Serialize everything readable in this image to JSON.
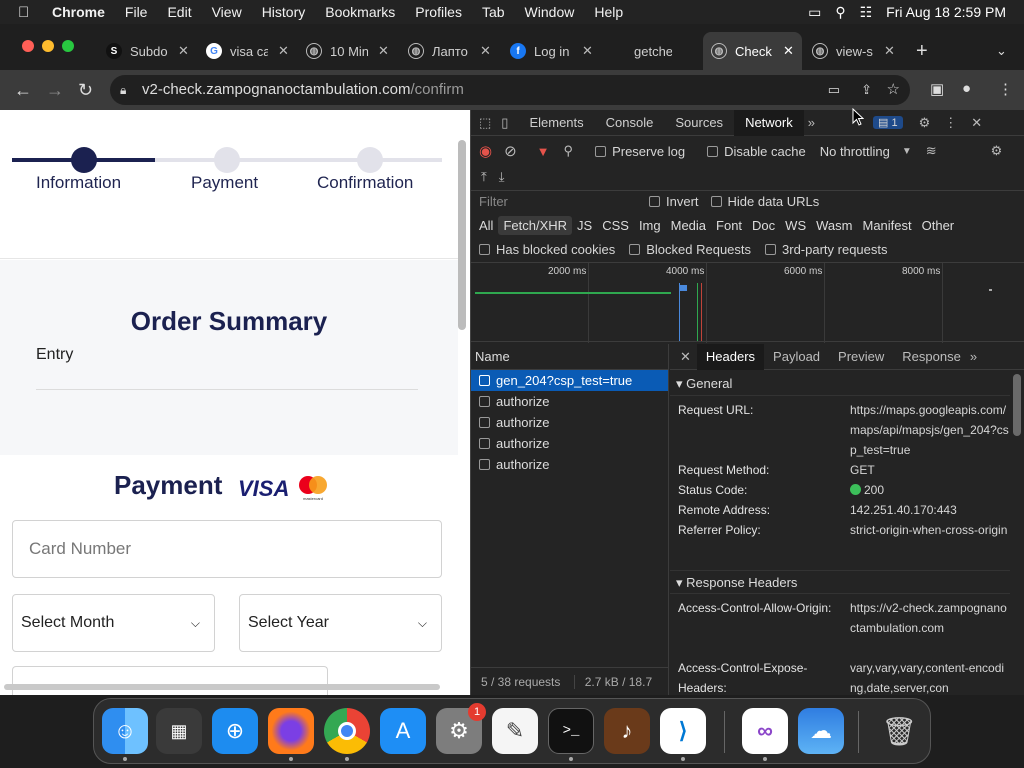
{
  "menubar": {
    "app": "Chrome",
    "items": [
      "File",
      "Edit",
      "View",
      "History",
      "Bookmarks",
      "Profiles",
      "Tab",
      "Window",
      "Help"
    ],
    "datetime": "Fri Aug 18  2:59 PM"
  },
  "tabs": [
    {
      "title": "Subdo",
      "icon": "s-favicon"
    },
    {
      "title": "visa ca",
      "icon": "google-favicon"
    },
    {
      "title": "10 Min",
      "icon": "globe-favicon"
    },
    {
      "title": "Лапто",
      "icon": "globe-favicon"
    },
    {
      "title": "Log in",
      "icon": "facebook-favicon"
    },
    {
      "title": "getche",
      "icon": "none"
    },
    {
      "title": "Check",
      "icon": "globe-favicon",
      "active": true
    },
    {
      "title": "view-s",
      "icon": "globe-favicon"
    }
  ],
  "address": {
    "host": "v2-check.zampognanoctambulation.com",
    "path": "/confirm"
  },
  "checkout": {
    "steps": [
      "Information",
      "Payment",
      "Confirmation"
    ],
    "order_title": "Order Summary",
    "entry_label": "Entry",
    "payment_title": "Payment",
    "visa_label": "VISA",
    "mastercard_label": "mastercard",
    "card_placeholder": "Card Number",
    "month_select": "Select Month",
    "year_select": "Select Year",
    "brand_color": "#1b2150"
  },
  "devtools": {
    "tabs": [
      "Elements",
      "Console",
      "Sources",
      "Network"
    ],
    "active_tab": "Network",
    "issues_count": "1",
    "preserve_log": "Preserve log",
    "disable_cache": "Disable cache",
    "throttling": "No throttling",
    "filter_placeholder": "Filter",
    "invert": "Invert",
    "hide_data_urls": "Hide data URLs",
    "filter_types": [
      "All",
      "Fetch/XHR",
      "JS",
      "CSS",
      "Img",
      "Media",
      "Font",
      "Doc",
      "WS",
      "Wasm",
      "Manifest",
      "Other"
    ],
    "active_filter": "Fetch/XHR",
    "blocked_cookies": "Has blocked cookies",
    "blocked_requests": "Blocked Requests",
    "third_party": "3rd-party requests",
    "timeline_ticks": [
      "2000 ms",
      "4000 ms",
      "6000 ms",
      "8000 ms"
    ],
    "name_header": "Name",
    "requests": [
      "gen_204?csp_test=true",
      "authorize",
      "authorize",
      "authorize",
      "authorize"
    ],
    "status_requests": "5 / 38 requests",
    "status_size": "2.7 kB / 18.7 kB",
    "detail_tabs": [
      "Headers",
      "Payload",
      "Preview",
      "Response"
    ],
    "general_label": "General",
    "general": [
      {
        "key": "Request URL:",
        "value": "https://maps.googleapis.com/maps/api/mapsjs/gen_204?csp_test=true"
      },
      {
        "key": "Request Method:",
        "value": "GET"
      },
      {
        "key": "Status Code:",
        "value": "200"
      },
      {
        "key": "Remote Address:",
        "value": "142.251.40.170:443"
      },
      {
        "key": "Referrer Policy:",
        "value": "strict-origin-when-cross-origin"
      }
    ],
    "response_label": "Response Headers",
    "response": [
      {
        "key": "Access-Control-Allow-Origin:",
        "value": "https://v2-check.zampognanoctambulation.com"
      },
      {
        "key": "Access-Control-Expose-Headers:",
        "value": "vary,vary,vary,content-encoding,date,server,con"
      }
    ],
    "status_ok_color": "#3cbf5a"
  },
  "dock": {
    "apps": [
      "finder-icon",
      "launchpad-icon",
      "safari-icon",
      "firefox-icon",
      "chrome-icon",
      "app-store-icon",
      "system-settings-icon",
      "textedit-icon",
      "terminal-icon",
      "garageband-icon",
      "vscode-icon",
      "visual-studio-icon",
      "weather-icon",
      "trash-icon"
    ],
    "settings_badge": "1"
  }
}
